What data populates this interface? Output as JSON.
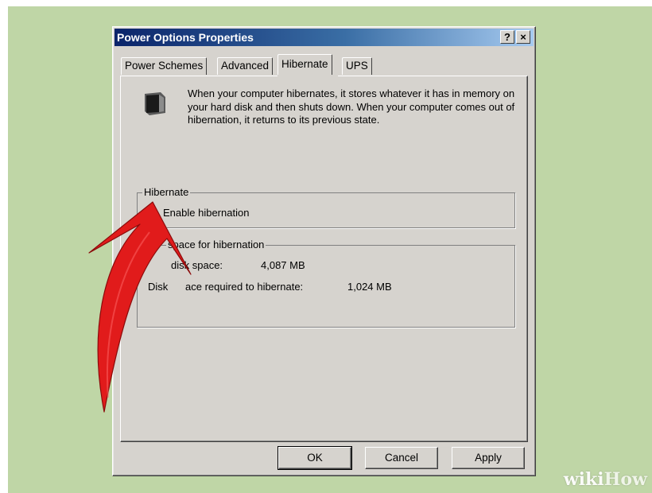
{
  "window": {
    "title": "Power Options Properties",
    "help_button": "?",
    "close_button": "×"
  },
  "tabs": [
    {
      "label": "Power Schemes",
      "active": false
    },
    {
      "label": "Advanced",
      "active": false
    },
    {
      "label": "Hibernate",
      "active": true
    },
    {
      "label": "UPS",
      "active": false
    }
  ],
  "hibernate_tab": {
    "icon": "hibernate-monitor-moon-icon",
    "description": "When your computer hibernates, it stores whatever it has in memory on your hard disk and then shuts down. When your computer comes out of hibernation, it returns to its previous state.",
    "hibernate_group": {
      "title": "Hibernate",
      "checkbox_label": "Enable hibernation",
      "checked": false
    },
    "disk_space_group": {
      "title": "space for hibernation",
      "free_label": "disk space:",
      "free_value": "4,087 MB",
      "required_label_left": "Disk",
      "required_label_right": "ace required to hibernate:",
      "required_value": "1,024 MB"
    }
  },
  "buttons": {
    "ok": "OK",
    "cancel": "Cancel",
    "apply": "Apply"
  },
  "annotation": {
    "icon": "red-arrow-pointer",
    "color": "#e11b1b"
  },
  "watermark": {
    "wiki": "wiki",
    "how": "How"
  },
  "colors": {
    "background": "#bfd6a6",
    "dialog": "#d6d3ce",
    "titlebar_start": "#0a246a",
    "titlebar_end": "#a6caf0"
  }
}
